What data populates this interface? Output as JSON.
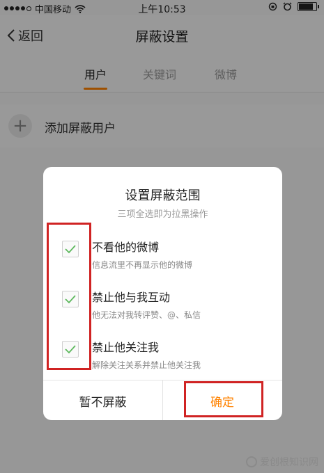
{
  "status_bar": {
    "carrier": "中国移动",
    "time": "上午10:53",
    "battery_level": 0.85
  },
  "nav": {
    "back_label": "返回",
    "title": "屏蔽设置"
  },
  "tabs": [
    {
      "label": "用户",
      "active": true
    },
    {
      "label": "关键词",
      "active": false
    },
    {
      "label": "微博",
      "active": false
    }
  ],
  "add_row": {
    "label": "添加屏蔽用户"
  },
  "dialog": {
    "title": "设置屏蔽范围",
    "subtitle": "三项全选即为拉黑操作",
    "options": [
      {
        "title": "不看他的微博",
        "desc": "信息流里不再显示他的微博",
        "checked": true
      },
      {
        "title": "禁止他与我互动",
        "desc": "他无法对我转评赞、@、私信",
        "checked": true
      },
      {
        "title": "禁止他关注我",
        "desc": "解除关注关系并禁止他关注我",
        "checked": true
      }
    ],
    "cancel_label": "暂不屏蔽",
    "confirm_label": "确定"
  },
  "watermark": {
    "text": "爱创根知识网"
  },
  "colors": {
    "accent": "#ff8200",
    "check": "#5cb85c",
    "annotation": "#d02323"
  }
}
